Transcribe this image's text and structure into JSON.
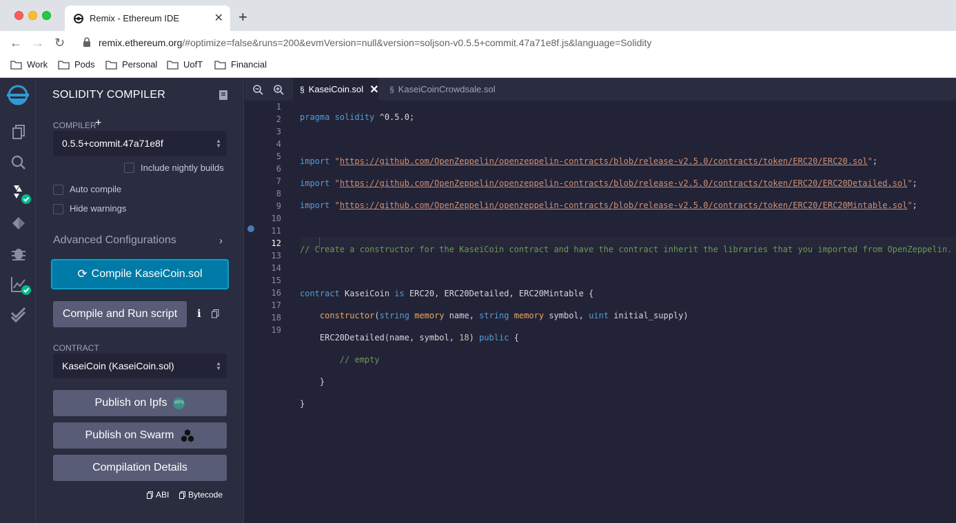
{
  "browser": {
    "tab_title": "Remix - Ethereum IDE",
    "url_host": "remix.ethereum.org",
    "url_rest": "/#optimize=false&runs=200&evmVersion=null&version=soljson-v0.5.5+commit.47a71e8f.js&language=Solidity",
    "bookmarks": [
      "Work",
      "Pods",
      "Personal",
      "UofT",
      "Financial"
    ]
  },
  "sidebar": {
    "title": "SOLIDITY COMPILER",
    "compiler_label": "COMPILER",
    "compiler_plus": "+",
    "compiler_version": "0.5.5+commit.47a71e8f",
    "include_nightly": "Include nightly builds",
    "auto_compile": "Auto compile",
    "hide_warnings": "Hide warnings",
    "advanced": "Advanced Configurations",
    "compile_button": "Compile KaseiCoin.sol",
    "compile_run_button": "Compile and Run script",
    "contract_label": "CONTRACT",
    "contract_value": "KaseiCoin (KaseiCoin.sol)",
    "publish_ipfs": "Publish on Ipfs",
    "ipfs_badge": "IPFS",
    "publish_swarm": "Publish on Swarm",
    "compilation_details": "Compilation Details",
    "abi": "ABI",
    "bytecode": "Bytecode"
  },
  "editor": {
    "tabs": [
      {
        "label": "KaseiCoin.sol",
        "active": true
      },
      {
        "label": "KaseiCoinCrowdsale.sol",
        "active": false
      }
    ],
    "current_line": 12,
    "line_numbers": [
      "1",
      "2",
      "3",
      "4",
      "5",
      "6",
      "7",
      "8",
      "9",
      "10",
      "11",
      "12",
      "13",
      "14",
      "15",
      "16",
      "17",
      "18",
      "19"
    ],
    "code": {
      "l1_kw": "pragma solidity",
      "l1_ver": " ^0.5.0;",
      "import_kw": "import",
      "imp1": "https://github.com/OpenZeppelin/openzeppelin-contracts/blob/release-v2.5.0/contracts/token/ERC20/ERC20.sol",
      "imp2": "https://github.com/OpenZeppelin/openzeppelin-contracts/blob/release-v2.5.0/contracts/token/ERC20/ERC20Detailed.sol",
      "imp3": "https://github.com/OpenZeppelin/openzeppelin-contracts/blob/release-v2.5.0/contracts/token/ERC20/ERC20Mintable.sol",
      "comment": "// Create a constructor for the KaseiCoin contract and have the contract inherit the libraries that you imported from OpenZeppelin.",
      "contract_kw": "contract",
      "contract_name": " KaseiCoin ",
      "is_kw": "is",
      "inherits": " ERC20, ERC20Detailed, ERC20Mintable {",
      "constructor": "constructor",
      "string": "string",
      "memory": "memory",
      "uint": "uint",
      "p_name": " name, ",
      "p_symbol": " symbol, ",
      "p_supply": " initial_supply)",
      "detailed_call": "ERC20Detailed(name, symbol, ",
      "decimals": "18",
      "public_kw": "public",
      "empty_comment": "// empty"
    }
  }
}
